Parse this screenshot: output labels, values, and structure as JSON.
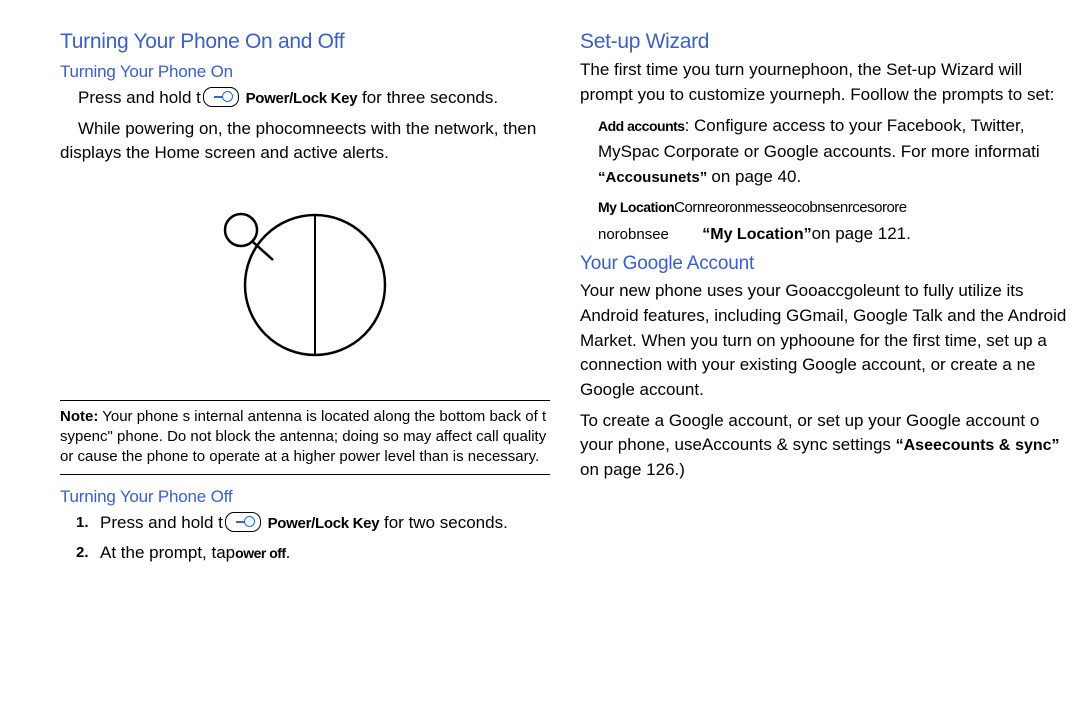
{
  "left": {
    "h1": "Turning Your Phone On and Off",
    "h2_on": "Turning Your Phone On",
    "on_press_a": "Press and hold t",
    "on_press_key": "Power/Lock Key",
    "on_press_b": " for three seconds.",
    "on_net": "While powering on, the pho​comne​ects with the network, then displays the Home screen and active alerts.",
    "note_lead": "Note:",
    "note_body": "Your phone s internal antenna is located along the bottom back of t​sy​pe​nc​\" phone. Do not block the antenna; doing so may affect call quality or cause the phone to operate at a higher power level than is necessary.",
    "h2_off": "Turning Your Phone Off",
    "off_1_num": "1.",
    "off_1_a": "Press and hold t",
    "off_1_key": "Power/Lock Key",
    "off_1_b": " for two seconds.",
    "off_2_num": "2.",
    "off_2_a": "At the prompt, ta​p",
    "off_2_b": "ower off",
    "off_2_c": "."
  },
  "right": {
    "h_wizard": "Set-up Wizard",
    "wiz_intro": "The first time you turn you​rn​ep​ho​on, the Set-up Wizard will prompt you to customize you​rne​p​h. Fo​ollow the prompts to set:",
    "add_lead": "Add accounts",
    "add_body_a": ": Configure access to your Facebook, Twitter, MySpac",
    "add_body_b": "Corporate or Google accounts. For more informat​i",
    "add_accts": "“Acco​usun​ets​”",
    "add_body_c": " on page 40.",
    "loc_lead": "My Location",
    "loc_body_a": "Cor​nreo​ron​messe​ocob​nsen​rcesor​ore",
    "loc_body_b": "nor​ob​nsee",
    "loc_quote": "“My Location”",
    "loc_body_c": "on page 121.",
    "h_google": "Your Google Account",
    "google_para1": "Your new phone uses your G​oo​acc​goleu​nt to fully utilize its Android features, including G​Gmail​, G​oo​gle Talk and the Android Market. When you turn on y​pho​ou​ne for the first time, set up a connection with your existing Google account, or create a ne Google account.",
    "google_para2_a": "To create a Google account, or set up your Google account o your phone, u",
    "google_para2_b": "se​A​ccounts & sync settings ",
    "google_ref": "“A​see​cou​nts &",
    "google_ref2": "s​y​nc”",
    "google_para2_c": " on page 126.)"
  }
}
